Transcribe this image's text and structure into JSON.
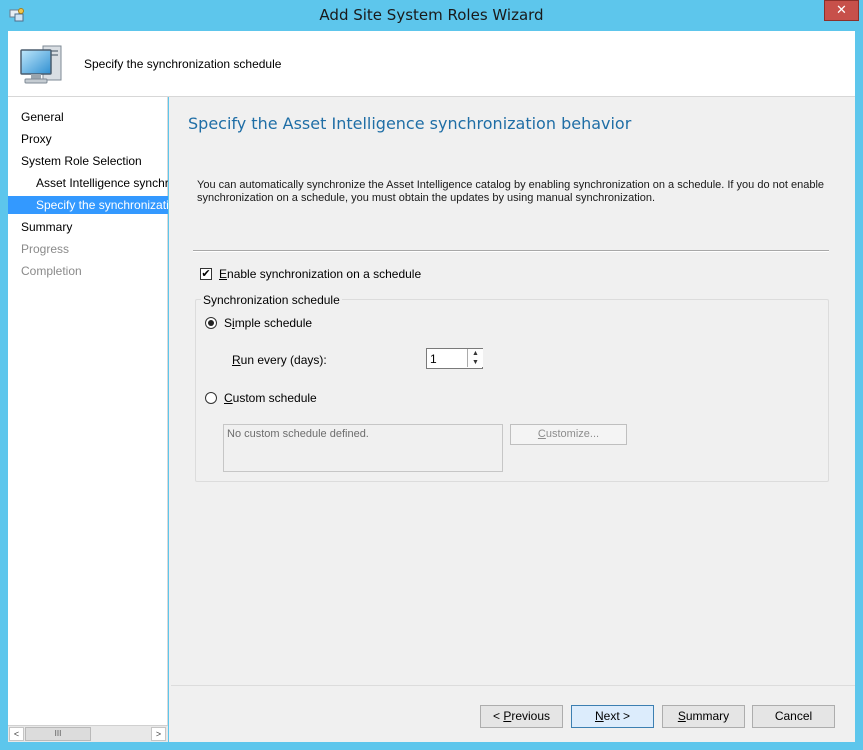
{
  "window": {
    "title": "Add Site System Roles Wizard",
    "close_label": "✕"
  },
  "banner": {
    "title": "Specify the synchronization schedule"
  },
  "nav": {
    "items": [
      {
        "label": "General",
        "state": "normal"
      },
      {
        "label": "Proxy",
        "state": "normal"
      },
      {
        "label": "System Role Selection",
        "state": "normal"
      },
      {
        "label": "Asset Intelligence synchronization point",
        "state": "normal"
      },
      {
        "label": "Specify the synchronization schedule",
        "state": "selected"
      },
      {
        "label": "Summary",
        "state": "normal"
      },
      {
        "label": "Progress",
        "state": "disabled"
      },
      {
        "label": "Completion",
        "state": "disabled"
      }
    ],
    "scroll_left": "<",
    "scroll_thumb": "III",
    "scroll_right": ">"
  },
  "main": {
    "heading": "Specify the Asset Intelligence synchronization behavior",
    "description": "You can automatically synchronize the Asset Intelligence catalog by enabling synchronization on a schedule. If you do not enable synchronization on a schedule, you must obtain the updates by using manual synchronization.",
    "enable_checkbox": {
      "label_first": "E",
      "label_rest": "nable synchronization on a schedule",
      "checked": true,
      "check_glyph": "✔"
    },
    "group_title": "Synchronization schedule",
    "simple_radio": {
      "label_pre": "S",
      "label_accel": "i",
      "label_rest": "mple schedule",
      "selected": true
    },
    "run_every": {
      "label_accel": "R",
      "label_rest": "un every (days):",
      "value": "1",
      "up_glyph": "▲",
      "down_glyph": "▼"
    },
    "custom_radio": {
      "label_accel": "C",
      "label_rest": "ustom schedule",
      "selected": false
    },
    "custom_schedule_text": "No custom schedule defined.",
    "customize_button": {
      "label_accel": "C",
      "label_rest": "ustomize..."
    }
  },
  "footer": {
    "previous": {
      "pre": "< ",
      "accel": "P",
      "rest": "revious"
    },
    "next": {
      "accel": "N",
      "rest": "ext >"
    },
    "summary": {
      "accel": "S",
      "rest": "ummary"
    },
    "cancel": "Cancel"
  }
}
